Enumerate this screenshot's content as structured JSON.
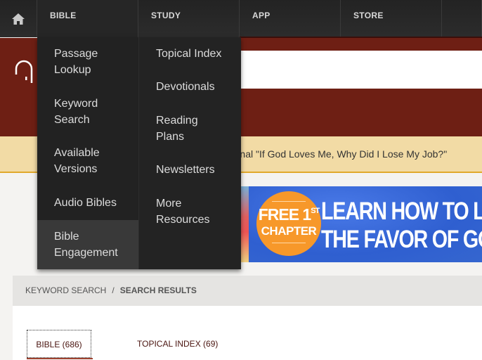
{
  "nav": {
    "home_icon": "home-icon",
    "items": [
      {
        "label": "BIBLE"
      },
      {
        "label": "STUDY"
      },
      {
        "label": "APP"
      },
      {
        "label": "STORE"
      }
    ]
  },
  "dropdown": {
    "bible_column": [
      {
        "label": "Passage Lookup"
      },
      {
        "label": "Keyword Search"
      },
      {
        "label": "Available Versions"
      },
      {
        "label": "Audio Bibles"
      },
      {
        "label": "Bible Engagement"
      }
    ],
    "study_column": [
      {
        "label": "Topical Index"
      },
      {
        "label": "Devotionals"
      },
      {
        "label": "Reading Plans"
      },
      {
        "label": "Newsletters"
      },
      {
        "label": "More Resources"
      }
    ]
  },
  "banner": {
    "logo_icon": "site-logo-icon",
    "search_value": ""
  },
  "notice": {
    "text": "Read the new devotional \"If God Loves Me, Why Did I Lose My Job?\""
  },
  "ad": {
    "badge_line1": "FREE 1",
    "badge_sup": "ST",
    "badge_line2": "CHAPTER",
    "headline_line1": "LEARN HOW TO LIVE IN",
    "headline_line2": "THE FAVOR OF GOD"
  },
  "breadcrumb": {
    "parent": "KEYWORD SEARCH",
    "separator": "/",
    "current": "SEARCH RESULTS"
  },
  "tabs": [
    {
      "label": "BIBLE (686)",
      "active": true
    },
    {
      "label": "TOPICAL INDEX (69)",
      "active": false
    }
  ],
  "colors": {
    "nav_bg": "#262626",
    "banner_bg": "#6e1f14",
    "notice_bg": "#f2dba5",
    "notice_border": "#e1a92c",
    "ad_blue": "#3566cf",
    "ad_badge": "#f7982a",
    "tab_text": "#4a1510"
  }
}
